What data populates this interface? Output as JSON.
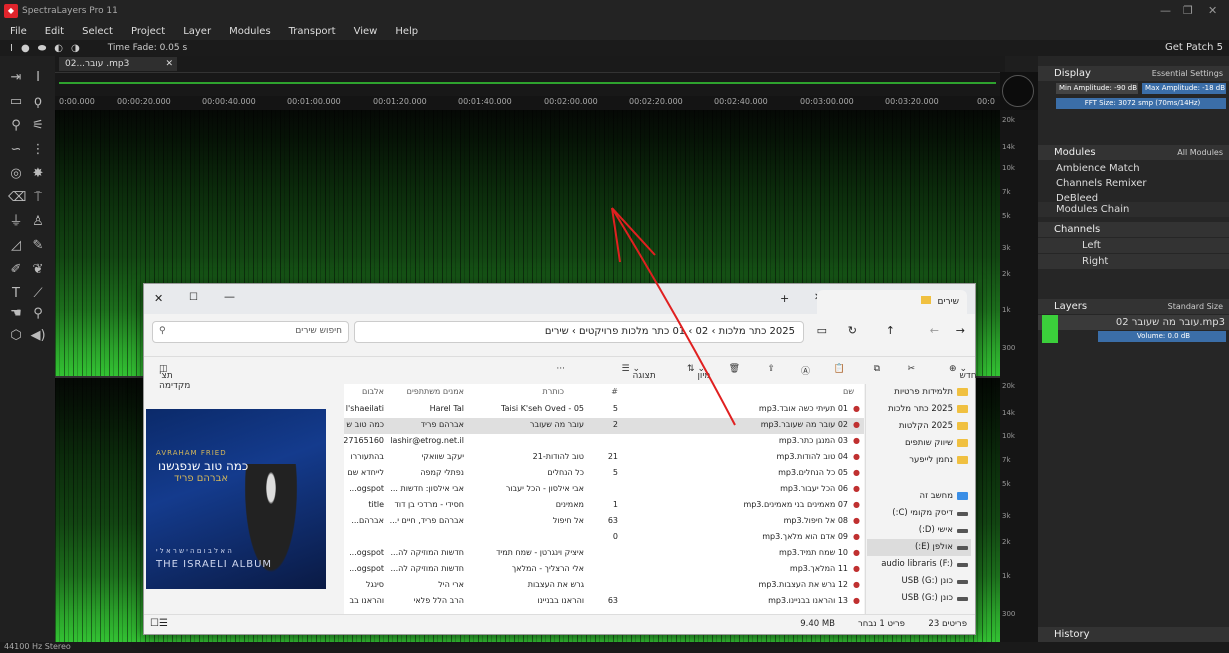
{
  "app": {
    "title": "SpectraLayers Pro 11"
  },
  "menu": [
    "File",
    "Edit",
    "Select",
    "Project",
    "Layer",
    "Modules",
    "Transport",
    "View",
    "Help"
  ],
  "toolbar": {
    "time_fade": "Time Fade: 0.05 s",
    "get_patch": "Get Patch 5"
  },
  "tab": {
    "label": "עובר...02 .mp3"
  },
  "ruler": [
    "0:00.000",
    "00:00:20.000",
    "00:00:40.000",
    "00:01:00.000",
    "00:01:20.000",
    "00:01:40.000",
    "00:02:00.000",
    "00:02:20.000",
    "00:02:40.000",
    "00:03:00.000",
    "00:03:20.000",
    "00:0"
  ],
  "freq_scale": [
    "20k",
    "14k",
    "10k",
    "7k",
    "5k",
    "3k",
    "2k",
    "1k",
    "300",
    "20k",
    "14k",
    "10k",
    "7k",
    "5k",
    "3k",
    "2k",
    "1k",
    "300"
  ],
  "display": {
    "title": "Display",
    "preset": "Essential Settings",
    "min_amp": "Min Amplitude: -90 dB",
    "max_amp": "Max Amplitude: -18 dB",
    "fft": "FFT Size: 3072 smp (70ms/14Hz)"
  },
  "modules": {
    "title": "Modules",
    "filter": "All Modules",
    "items": [
      "Ambience Match",
      "Channels Remixer",
      "DeBleed"
    ],
    "chain": "Modules Chain"
  },
  "channels": {
    "title": "Channels",
    "left": "Left",
    "right": "Right"
  },
  "layers": {
    "title": "Layers",
    "size": "Standard Size",
    "layer_name": "02 עובר מה שעובר.mp3",
    "volume": "Volume: 0.0 dB"
  },
  "history": {
    "title": "History"
  },
  "status": {
    "format": "44100 Hz Stereo"
  },
  "explorer": {
    "tab_title": "שירים",
    "address": "2025 כתר מלכות  ›  02  ›  01 כתר מלכות פרויקטים  ›  שירים",
    "address_more": "···",
    "search_placeholder": "חיפוש שירים",
    "new_label": "חדש",
    "sort_label": "מיון",
    "view_label": "תצוגה",
    "more_label": "···",
    "preview_label": "תצ' מקדימה",
    "columns": {
      "name": "שם",
      "num": "#",
      "title": "כותרת",
      "artists": "אמנים משתתפים",
      "album": "אלבום"
    },
    "nav": [
      {
        "label": "תלמידות פרטיות",
        "type": "folder"
      },
      {
        "label": "2025 כתר מלכות",
        "type": "folder"
      },
      {
        "label": "2025 הקלטות",
        "type": "folder"
      },
      {
        "label": "שיווק שותפים",
        "type": "folder"
      },
      {
        "label": "נחמן לייפער",
        "type": "folder"
      },
      {
        "label": "מחשב זה",
        "type": "pc"
      },
      {
        "label": "דיסק מקומי (C:)",
        "type": "drive"
      },
      {
        "label": "אישי (D:)",
        "type": "drive"
      },
      {
        "label": "אולפן (E:)",
        "type": "drive",
        "selected": true
      },
      {
        "label": "audio libraris (F:)",
        "type": "drive"
      },
      {
        "label": "כונן USB (G:)",
        "type": "drive"
      },
      {
        "label": "כונן USB (G:)",
        "type": "drive"
      }
    ],
    "rows": [
      {
        "name": "01 תעיתי כשה אובד.mp3",
        "num": "5",
        "title": "05 - Taisi K'seh Oved",
        "artists": "Harel Tal",
        "album": "l'shaeilati"
      },
      {
        "name": "02 עובר מה שעובר.mp3",
        "num": "2",
        "title": "עובר מה שעובר",
        "artists": "אברהם פריד",
        "album": "כמה טוב ש",
        "selected": true
      },
      {
        "name": "03 המנגן כתר.mp3",
        "num": "",
        "title": "",
        "artists": "lashir@etrog.net.il",
        "album": "27165160"
      },
      {
        "name": "04 טוב להודות.mp3",
        "num": "21",
        "title": "טוב להודות-21",
        "artists": "יעקב שוואקי",
        "album": "בהתעוררו"
      },
      {
        "name": "05 כל הנחלים.mp3",
        "num": "5",
        "title": "כל הנחלים",
        "artists": "נפתלי קמפה",
        "album": "לייחדא שם"
      },
      {
        "name": "06 הכל יעבור.mp3",
        "num": "",
        "title": "אבי אילסון - הכל יעבור",
        "artists": "אבי אילסון: חדשות ...",
        "album": "ogspot..."
      },
      {
        "name": "07 מאמינים בני מאמינים.mp3",
        "num": "1",
        "title": "מאמינים",
        "artists": "חסידי - מרדכי בן דוד",
        "album": "title"
      },
      {
        "name": "08 אל חיפול.mp3",
        "num": "63",
        "title": "אל חיפול",
        "artists": "אברהם פריד, חיים י...",
        "album": "אברהם..."
      },
      {
        "name": "09 אדם הוא מלאך.mp3",
        "num": "0",
        "title": "",
        "artists": "",
        "album": ""
      },
      {
        "name": "10 שמח תמיד.mp3",
        "num": "",
        "title": "איציק וינגרטן - שמח תמיד",
        "artists": "חדשות המוזיקה לה...",
        "album": "ogspot..."
      },
      {
        "name": "11 המלאך.mp3",
        "num": "",
        "title": "אלי הרצליך - המלאך",
        "artists": "חדשות המוזיקה לה...",
        "album": "ogspot..."
      },
      {
        "name": "12 גרש את העצבות.mp3",
        "num": "",
        "title": "גרש את העצבות",
        "artists": "ארי היל",
        "album": "סינגל"
      },
      {
        "name": "13 והראנו בבניינו.mp3",
        "num": "63",
        "title": "והראנו בבניינו",
        "artists": "הרב הלל פלאי",
        "album": "והראנו בב"
      }
    ],
    "preview": {
      "line1": "AVRAHAM FRIED",
      "line2": "כמה טוב שנפגשנו",
      "line3": "אברהם פריד",
      "line4": "THE ISRAELI ALBUM",
      "line5": "ה א ל ב ו ם   ה י ש ר א ל י"
    },
    "status": {
      "count": "23 פריטים",
      "selected": "פריט 1 נבחר",
      "size": "9.40 MB"
    }
  }
}
